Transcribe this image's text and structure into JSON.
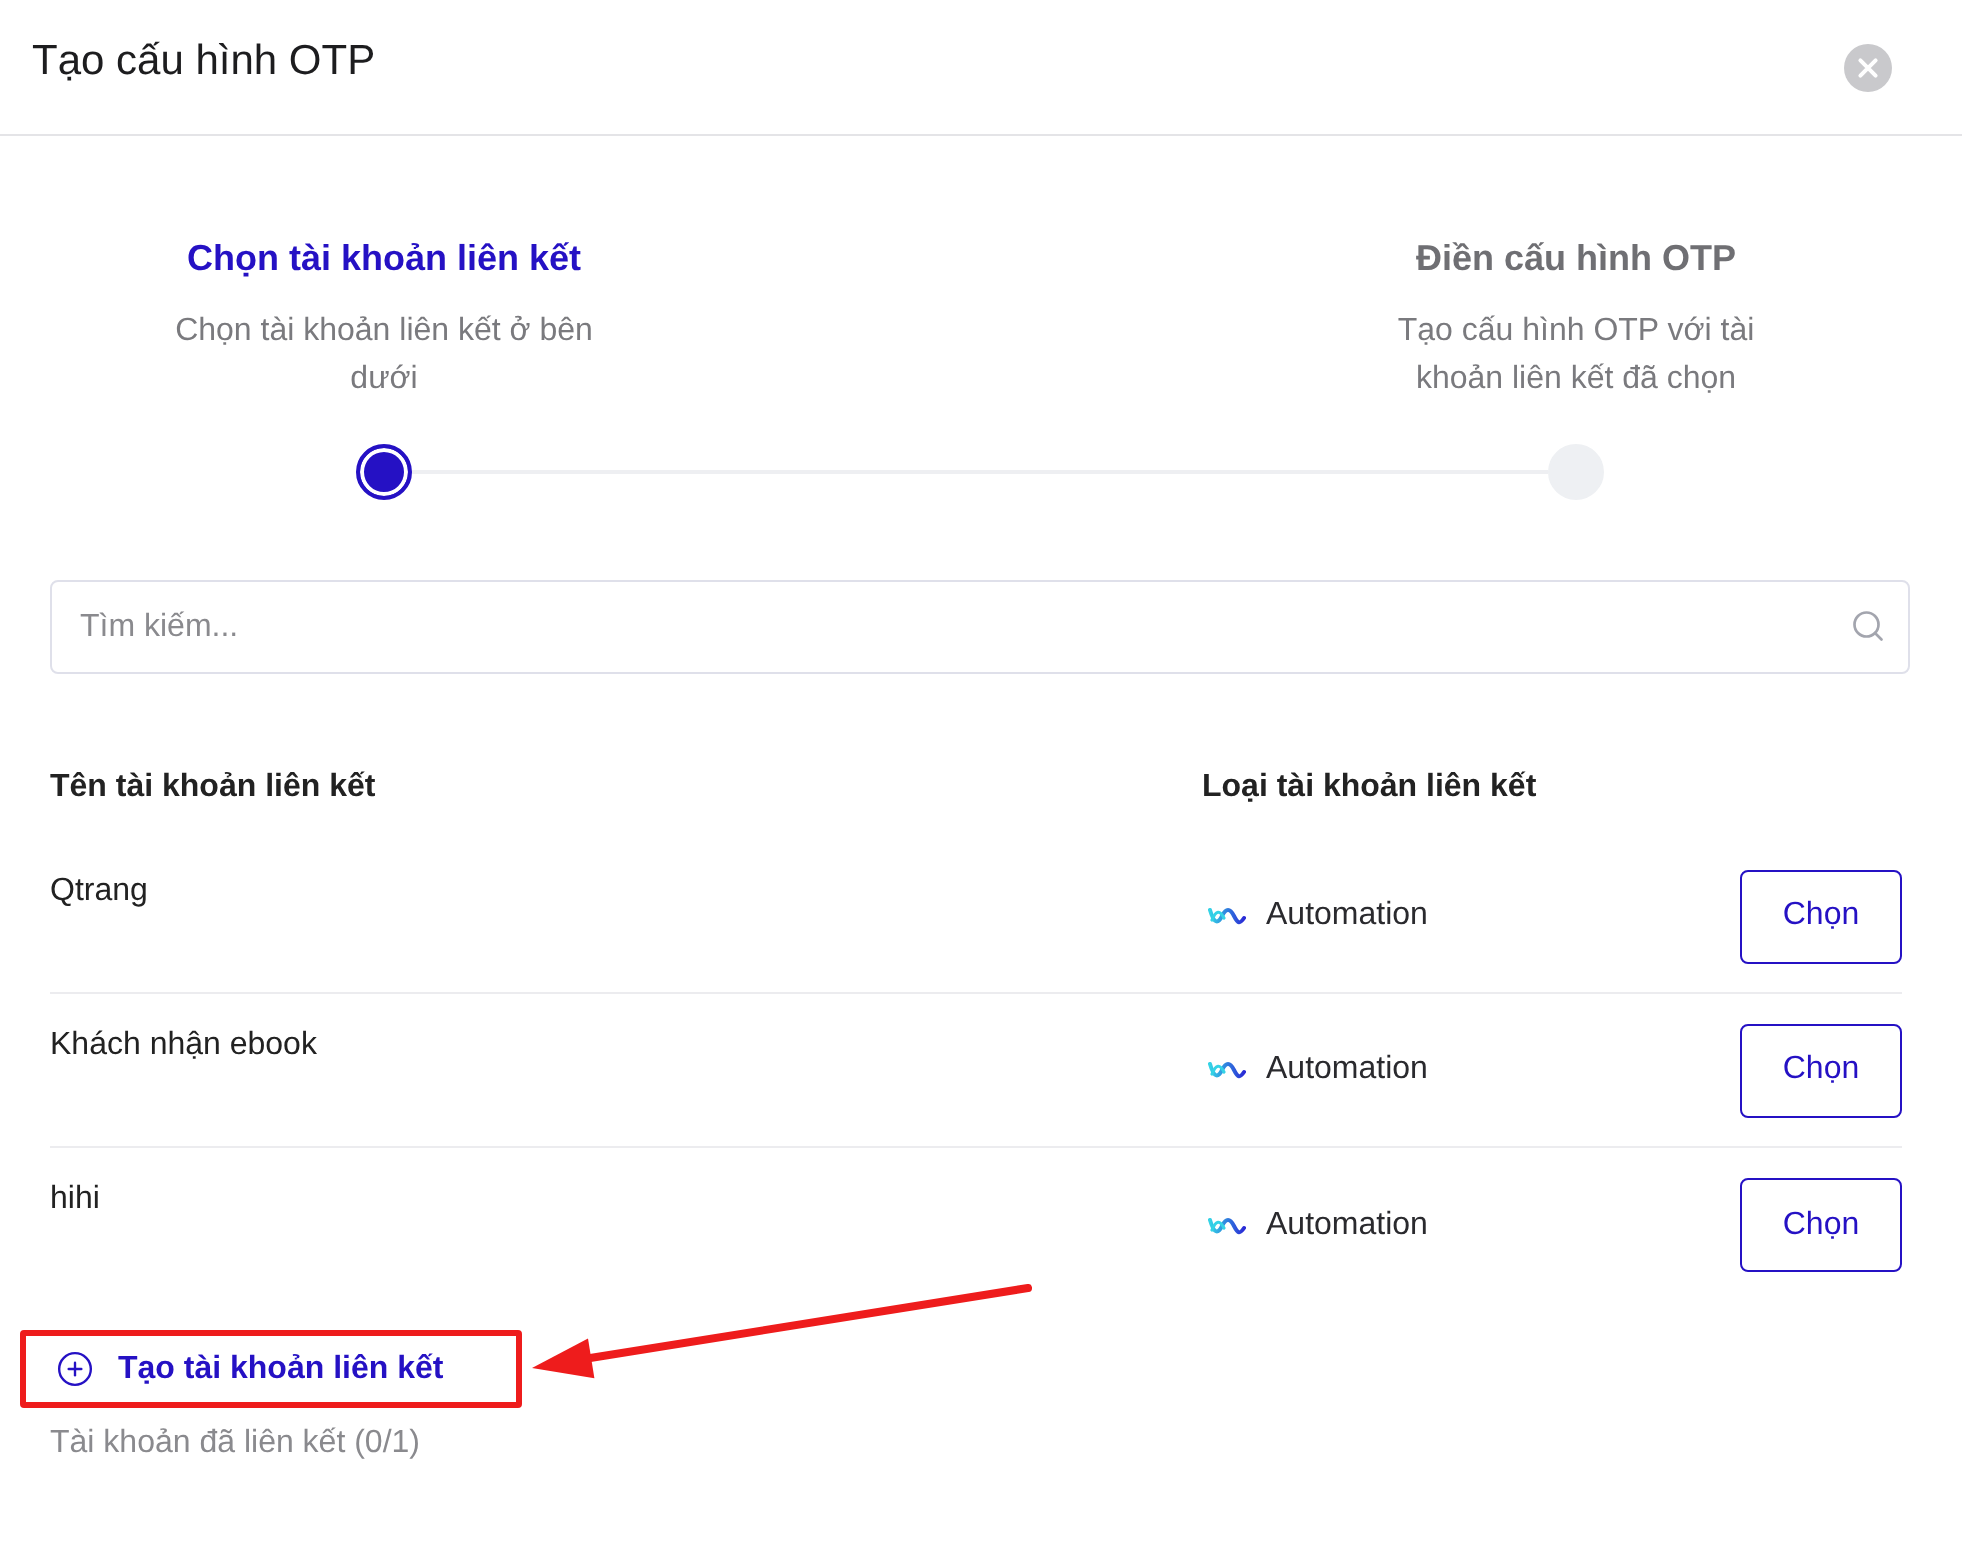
{
  "dialog": {
    "title": "Tạo cấu hình OTP"
  },
  "steps": [
    {
      "title": "Chọn tài khoản liên kết",
      "description": "Chọn tài khoản liên kết ở bên dưới",
      "active": true
    },
    {
      "title": "Điền cấu hình OTP",
      "description": "Tạo cấu hình OTP với tài khoản liên kết đã chọn",
      "active": false
    }
  ],
  "search": {
    "placeholder": "Tìm kiếm..."
  },
  "table": {
    "columns": [
      "Tên tài khoản liên kết",
      "Loại tài khoản liên kết"
    ],
    "rows": [
      {
        "name": "Qtrang",
        "type": "Automation",
        "action": "Chọn"
      },
      {
        "name": "Khách nhận ebook",
        "type": "Automation",
        "action": "Chọn"
      },
      {
        "name": "hihi",
        "type": "Automation",
        "action": "Chọn"
      }
    ]
  },
  "create_link": {
    "label": "Tạo tài khoản liên kết",
    "highlighted": true
  },
  "linked_count": "Tài khoản đã liên kết (0/1)"
}
